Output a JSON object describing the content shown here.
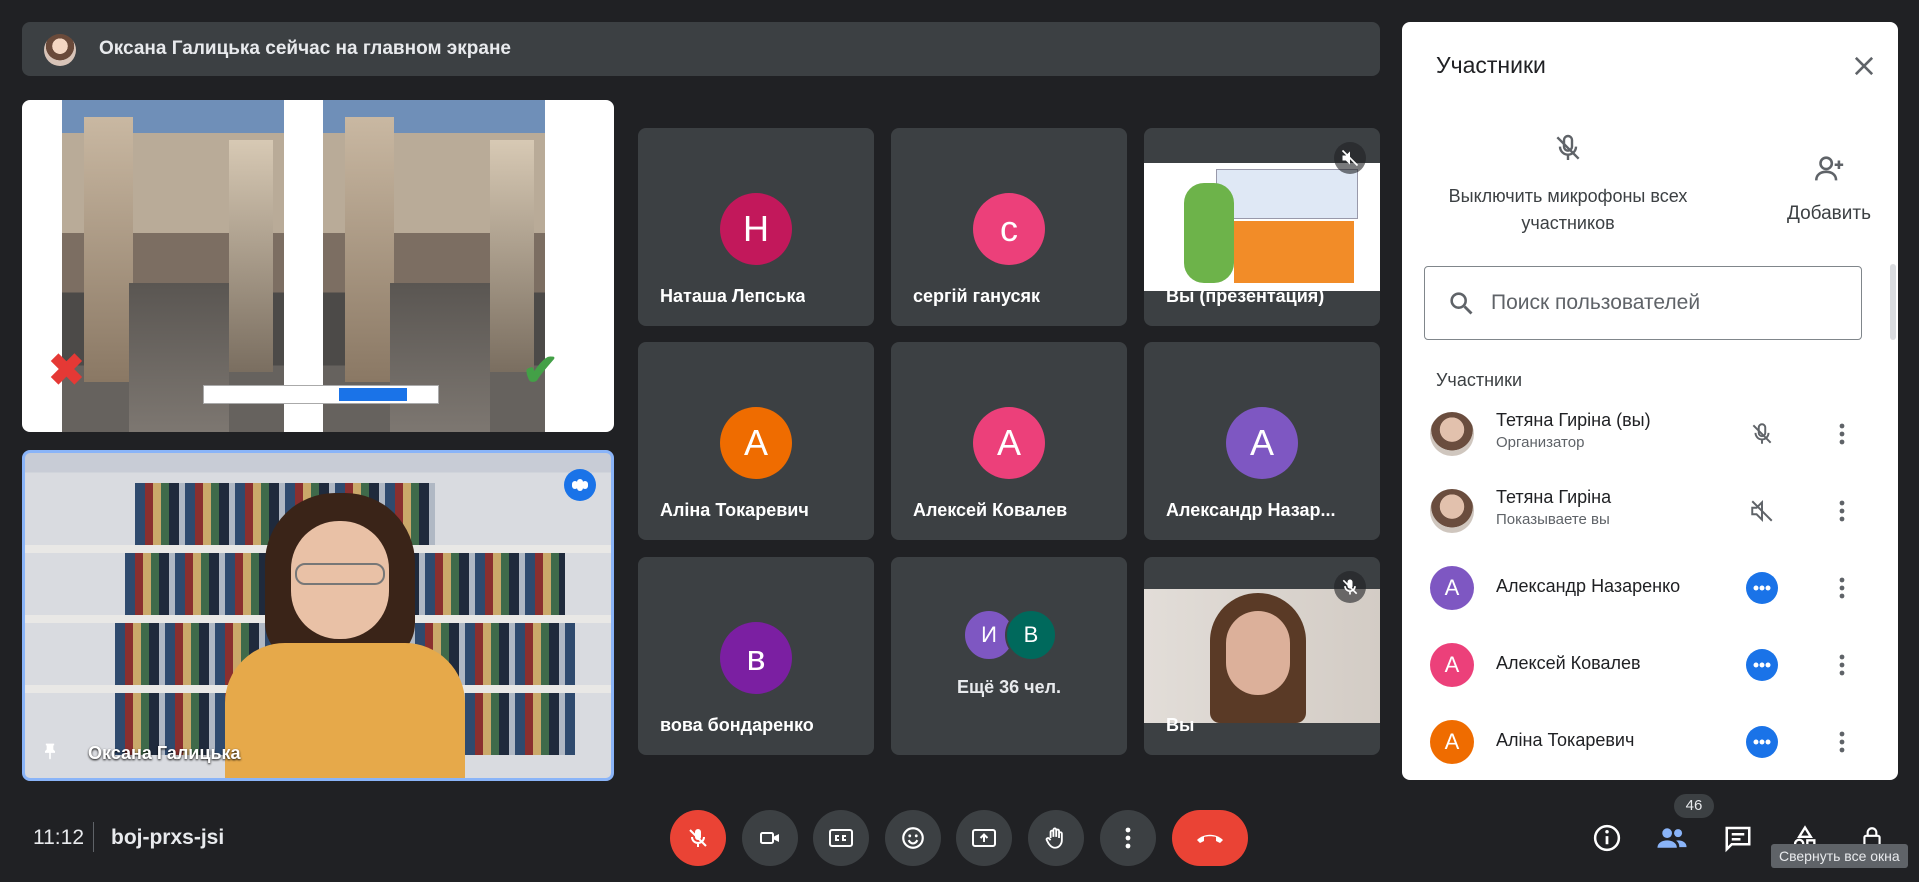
{
  "banner": {
    "text": "Оксана Галицька сейчас на главном экране"
  },
  "presenter": {
    "name": "Оксана Галицька"
  },
  "tiles": [
    {
      "name": "Наташа Лепська",
      "initial": "Н",
      "color": "#c2185b"
    },
    {
      "name": "сергій ганусяк",
      "initial": "с",
      "color": "#ec407a"
    },
    {
      "name": "Вы (презентация)"
    },
    {
      "name": "Аліна Токаревич",
      "initial": "А",
      "color": "#ef6c00"
    },
    {
      "name": "Алексей Ковалев",
      "initial": "А",
      "color": "#ec407a"
    },
    {
      "name": "Александр Назар...",
      "initial": "А",
      "color": "#7e57c2"
    },
    {
      "name": "вова бондаренко",
      "initial": "в",
      "color": "#7b1fa2"
    },
    {
      "more": "Ещё 36 чел.",
      "initials": [
        "И",
        "В"
      ],
      "colors": [
        "#7e57c2",
        "#00695c"
      ]
    },
    {
      "name": "Вы"
    }
  ],
  "panel": {
    "title": "Участники",
    "mute_all": "Выключить микрофоны всех участников",
    "add": "Добавить",
    "search_placeholder": "Поиск пользователей",
    "section": "Участники",
    "participants": [
      {
        "name": "Тетяна Гиріна (вы)",
        "role": "Организатор",
        "state": "mic-off-icon"
      },
      {
        "name": "Тетяна Гиріна",
        "role": "Показываете вы",
        "state": "volume-off-icon"
      },
      {
        "name": "Александр Назаренко",
        "initial": "А",
        "color": "#7e57c2",
        "state": "speaking-icon"
      },
      {
        "name": "Алексей Ковалев",
        "initial": "А",
        "color": "#ec407a",
        "state": "speaking-icon"
      },
      {
        "name": "Аліна Токаревич",
        "initial": "А",
        "color": "#ef6c00",
        "state": "speaking-icon"
      }
    ]
  },
  "bottom": {
    "time": "11:12",
    "code": "boj-prxs-jsi",
    "participant_count": "46",
    "tooltip": "Свернуть все окна"
  },
  "colors": {
    "accent": "#1a73e8",
    "danger": "#ea4335",
    "bg": "#202124",
    "surface": "#3c4043"
  }
}
